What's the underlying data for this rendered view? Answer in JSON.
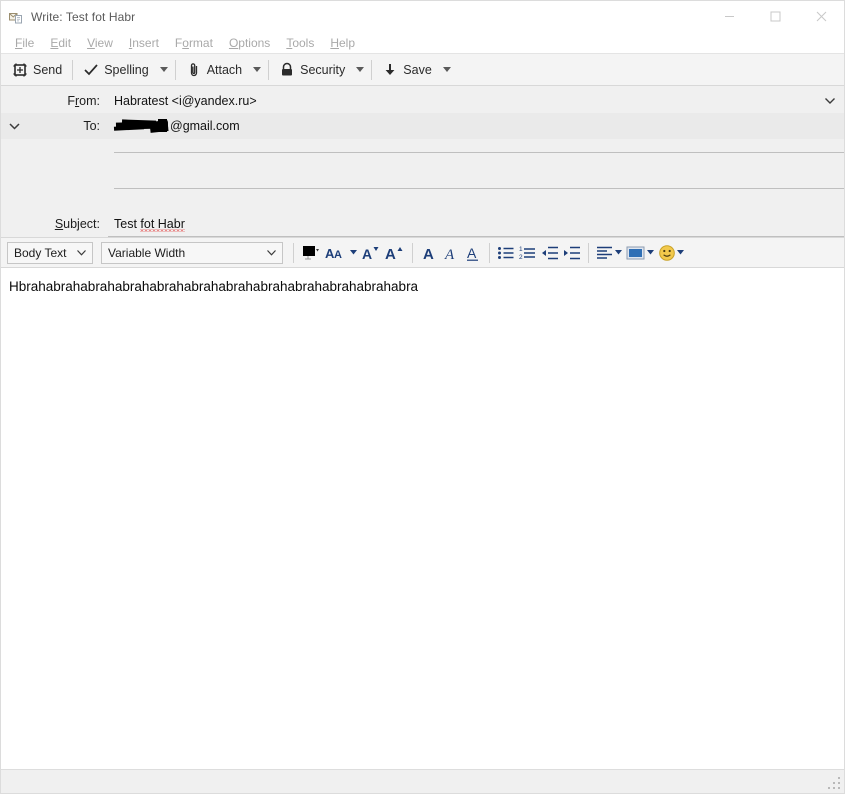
{
  "window": {
    "title": "Write: Test fot Habr",
    "icon": "compose-envelope-icon",
    "controls": {
      "minimize": "minimize-icon",
      "maximize": "maximize-icon",
      "close": "close-icon"
    }
  },
  "menubar": {
    "items": [
      {
        "label": "File",
        "accel": "F"
      },
      {
        "label": "Edit",
        "accel": "E"
      },
      {
        "label": "View",
        "accel": "V"
      },
      {
        "label": "Insert",
        "accel": "I"
      },
      {
        "label": "Format",
        "accel": "o"
      },
      {
        "label": "Options",
        "accel": "O"
      },
      {
        "label": "Tools",
        "accel": "T"
      },
      {
        "label": "Help",
        "accel": "H"
      }
    ]
  },
  "toolbar": {
    "buttons": [
      {
        "label": "Send",
        "icon": "send-icon",
        "has_menu": false
      },
      {
        "label": "Spelling",
        "icon": "check-icon",
        "has_menu": true
      },
      {
        "label": "Attach",
        "icon": "paperclip-icon",
        "has_menu": true
      },
      {
        "label": "Security",
        "icon": "lock-icon",
        "has_menu": true
      },
      {
        "label": "Save",
        "icon": "download-icon",
        "has_menu": true
      }
    ]
  },
  "headers": {
    "from": {
      "label": "From:",
      "accel": "r",
      "value": "Habratest <i@yandex.ru>",
      "chevron": "chevron-down-icon"
    },
    "to": {
      "label": "To:",
      "value_suffix": "@gmail.com",
      "redacted": true,
      "expander": "chevron-down-icon"
    },
    "empty_rows": 2,
    "subject": {
      "label": "Subject:",
      "accel": "S",
      "value": "Test fot Habr",
      "misspelled": [
        "fot",
        "Habr"
      ]
    }
  },
  "format_toolbar": {
    "paragraph_style": {
      "value": "Body Text",
      "caret": "chevron-down-icon"
    },
    "font_family": {
      "value": "Variable Width",
      "caret": "chevron-down-icon"
    },
    "color": "#000000",
    "buttons": [
      {
        "name": "text-color-swatch",
        "icon": "color-swatch-icon",
        "has_menu": true
      },
      {
        "name": "font-size",
        "icon": "font-size-icon",
        "has_menu": true
      },
      {
        "name": "decrease-font-size",
        "icon": "font-smaller-icon",
        "has_menu": false
      },
      {
        "name": "increase-font-size",
        "icon": "font-larger-icon",
        "has_menu": false
      },
      {
        "name": "bold",
        "icon": "bold-icon",
        "has_menu": false
      },
      {
        "name": "italic",
        "icon": "italic-icon",
        "has_menu": false
      },
      {
        "name": "underline",
        "icon": "underline-icon",
        "has_menu": false
      },
      {
        "name": "bullet-list",
        "icon": "bullet-list-icon",
        "has_menu": false
      },
      {
        "name": "numbered-list",
        "icon": "numbered-list-icon",
        "has_menu": false
      },
      {
        "name": "decrease-indent",
        "icon": "outdent-icon",
        "has_menu": false
      },
      {
        "name": "increase-indent",
        "icon": "indent-icon",
        "has_menu": false
      },
      {
        "name": "align",
        "icon": "align-left-icon",
        "has_menu": true
      },
      {
        "name": "insert-object",
        "icon": "insert-image-icon",
        "has_menu": true
      },
      {
        "name": "insert-smiley",
        "icon": "smiley-icon",
        "has_menu": true
      }
    ]
  },
  "body": {
    "text": "Hbrahabrahabrahabrahabrahabrahabrahabrahabrahabrahabrahabra"
  },
  "statusbar": {
    "text": "",
    "grip": "resize-grip-icon"
  },
  "colors": {
    "toolbar_bg": "#f4f4f4",
    "header_bg": "#f0f0f0",
    "icon_blue": "#1d3e79",
    "title_text": "#5a5a5a",
    "menu_text": "#a9a9a9",
    "smiley_yellow": "#f2c94c"
  }
}
